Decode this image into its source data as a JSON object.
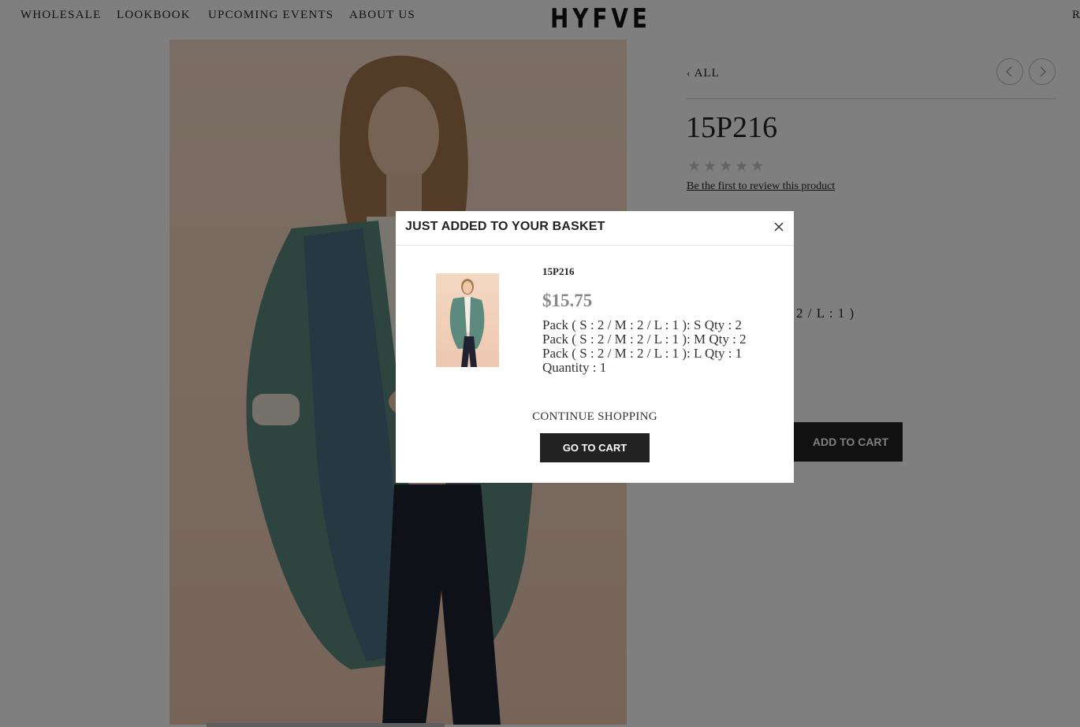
{
  "nav": {
    "links": [
      "WHOLESALE",
      "LOOKBOOK",
      "UPCOMING EVENTS",
      "ABOUT US"
    ],
    "logo": "HYFVE",
    "cut_link": "R"
  },
  "product": {
    "back_label": "ALL",
    "title": "15P216",
    "stars": "★★★★★",
    "review_link": "Be the first to review this product",
    "pack_fragment": "2 / L : 1 )",
    "add_to_cart_label": "ADD TO CART"
  },
  "modal": {
    "title": "JUST ADDED TO YOUR BASKET",
    "item_name": "15P216",
    "price": "$15.75",
    "options": [
      "Pack ( S : 2 / M : 2 / L : 1 ): S Qty : 2",
      "Pack ( S : 2 / M : 2 / L : 1 ): M Qty : 2",
      "Pack ( S : 2 / M : 2 / L : 1 ): L Qty : 1"
    ],
    "quantity": "Quantity : 1",
    "continue_label": "CONTINUE SHOPPING",
    "go_to_cart_label": "GO TO CART"
  },
  "icons": {
    "back": "chevron-left-icon",
    "prev": "arrow-left-icon",
    "next": "arrow-right-icon",
    "close": "close-icon",
    "rating": "star-icon"
  },
  "colors": {
    "overlay": "#000000",
    "button": "#222222",
    "price": "#888888",
    "image_bg": "#f3d2bd"
  }
}
